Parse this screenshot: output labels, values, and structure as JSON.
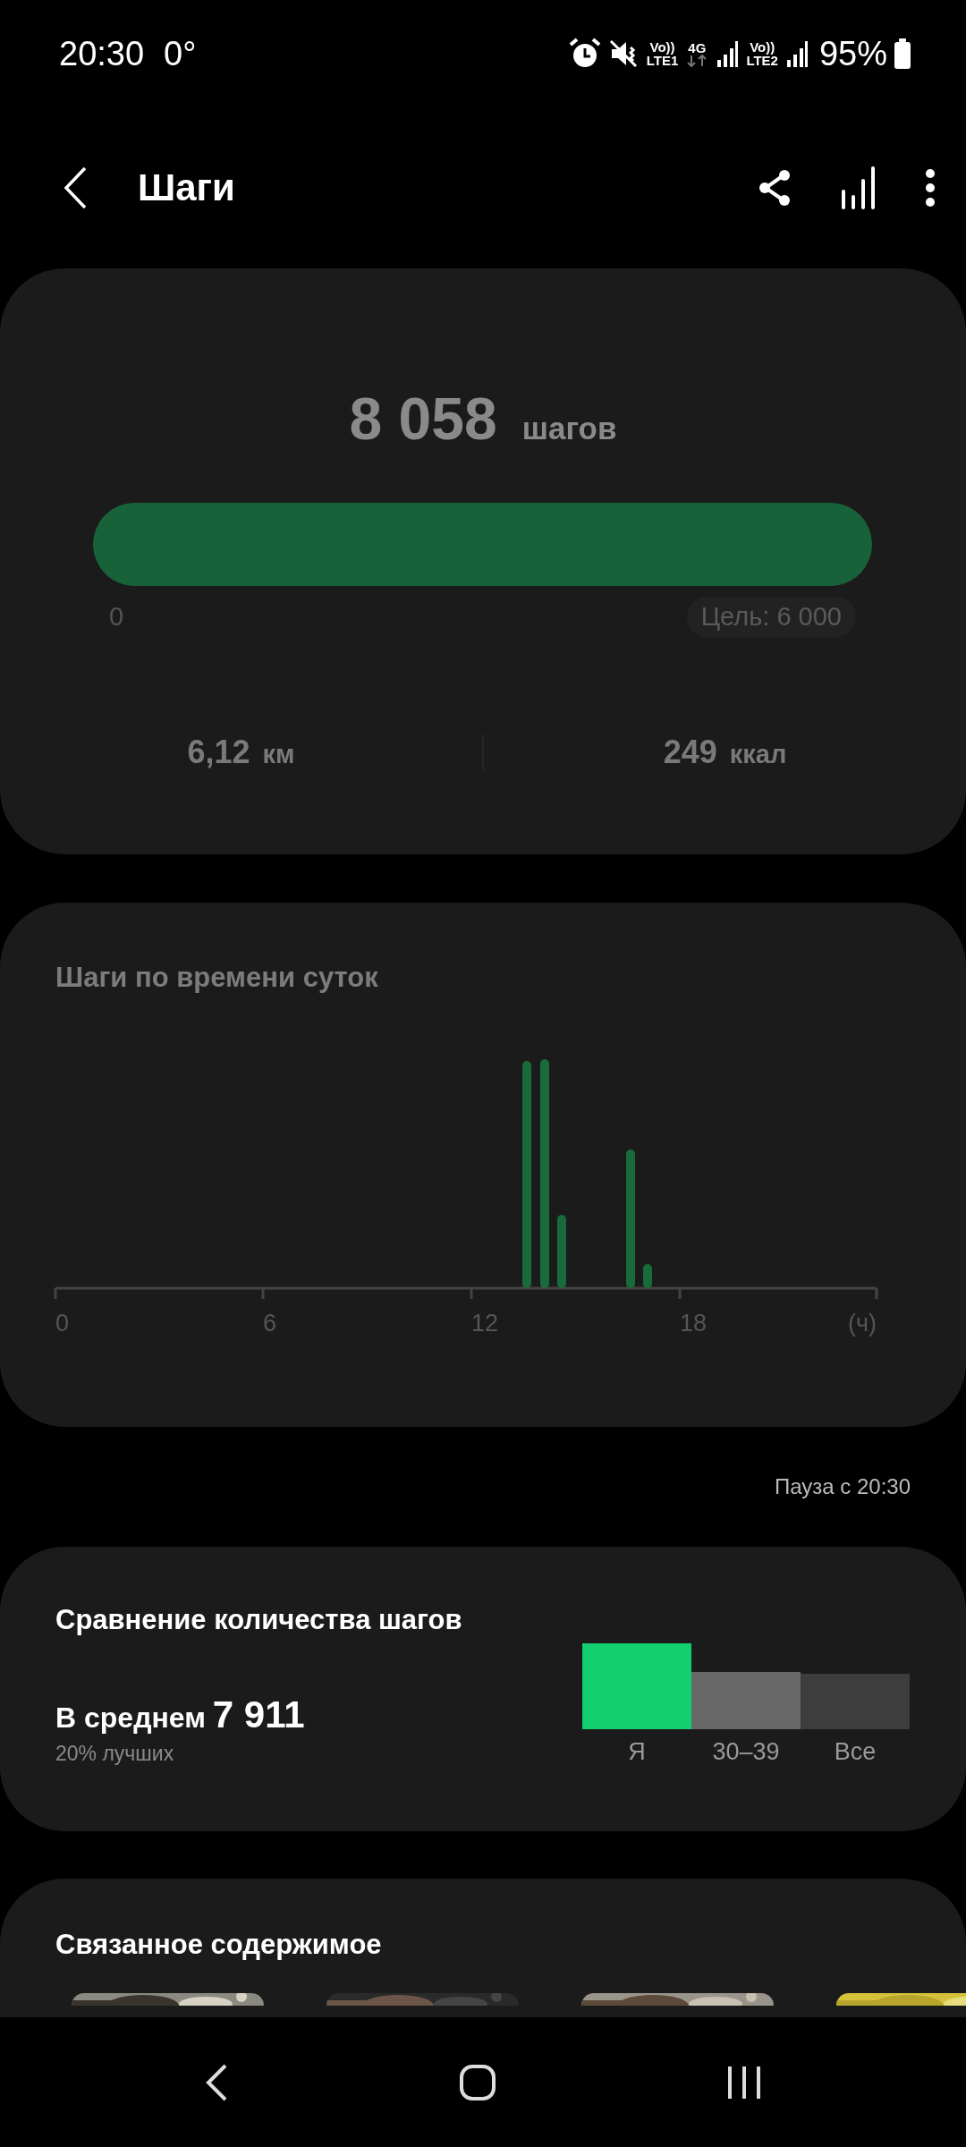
{
  "status_bar": {
    "time": "20:30",
    "temperature": "0°",
    "sim1": {
      "volte": "Vo))",
      "network": "LTE1"
    },
    "data": "4G",
    "sim2": {
      "volte": "Vo))",
      "network": "LTE2"
    },
    "battery": "95%"
  },
  "header": {
    "title": "Шаги"
  },
  "summary": {
    "steps": "8 058",
    "steps_unit": "шагов",
    "progress": {
      "level": 1
    },
    "scale_start": "0",
    "goal": "Цель: 6 000",
    "distance": "6,12",
    "distance_unit": "км",
    "calories": "249",
    "calories_unit": "ккал"
  },
  "hourly": {
    "title": "Шаги по времени суток",
    "axis_labels": [
      "0",
      "6",
      "12",
      "18",
      "(ч)"
    ]
  },
  "status_note": "Пауза с 20:30",
  "comparison": {
    "title": "Сравнение количества шагов",
    "average_label": "В среднем",
    "average": "7 911",
    "rank": "20% лучших",
    "groups": [
      {
        "label": "Я",
        "color": "#12d06e"
      },
      {
        "label": "30–39",
        "color": "#676767"
      },
      {
        "label": "Все",
        "color": "#3d3d3d"
      }
    ]
  },
  "related": {
    "title": "Связанное содержимое"
  }
}
